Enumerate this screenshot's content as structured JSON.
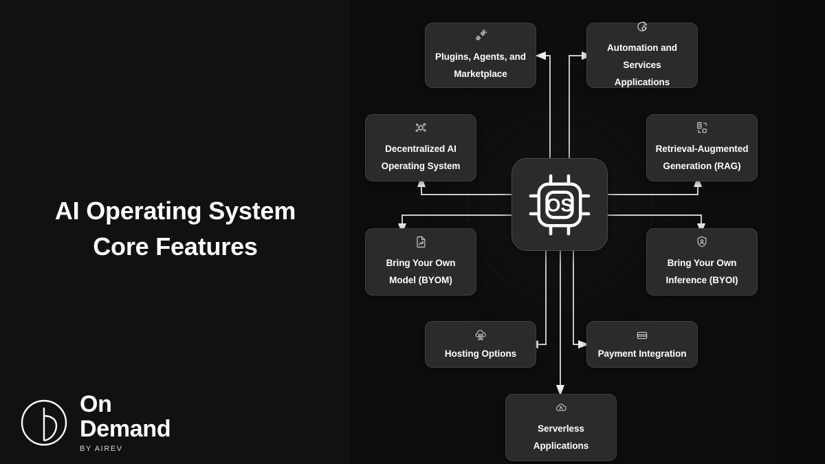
{
  "meta": {
    "title_line_1": "AI Operating System",
    "title_line_2": "Core Features",
    "background_left": "#111111",
    "background_right": "#0d0d0d",
    "card_background": "#2b2b2b",
    "card_border": "#3e3e3e",
    "text_color": "#ffffff",
    "connector_color": "#e8e8e8"
  },
  "logo": {
    "word_1": "On",
    "word_2": "Demand",
    "tagline": "BY AIREV",
    "mark_icon": "circle-d-logo-icon"
  },
  "hub": {
    "label": "OS",
    "icon": "cpu-chip-icon"
  },
  "cards": [
    {
      "id": "plugins-agents-marketplace",
      "icon": "plug-connect-icon",
      "line_1": "Plugins, Agents, and",
      "line_2": "Marketplace"
    },
    {
      "id": "automation-services-applications",
      "icon": "refresh-gear-icon",
      "line_1": "Automation and",
      "line_2": "Services Applications"
    },
    {
      "id": "decentralized-ai-operating-system",
      "icon": "network-nodes-icon",
      "line_1": "Decentralized AI",
      "line_2": "Operating System"
    },
    {
      "id": "retrieval-augmented-generation",
      "icon": "document-scan-icon",
      "line_1": "Retrieval-Augmented",
      "line_2": "Generation (RAG)"
    },
    {
      "id": "bring-your-own-model",
      "icon": "file-chart-icon",
      "line_1": "Bring Your Own",
      "line_2": "Model (BYOM)"
    },
    {
      "id": "bring-your-own-inference",
      "icon": "shield-user-icon",
      "line_1": "Bring Your Own",
      "line_2": "Inference (BYOI)"
    },
    {
      "id": "hosting-options",
      "icon": "cloud-server-icon",
      "line_1": "Hosting Options",
      "line_2": ""
    },
    {
      "id": "payment-integration",
      "icon": "credit-card-icon",
      "line_1": "Payment Integration",
      "line_2": ""
    },
    {
      "id": "serverless-applications",
      "icon": "cloud-lambda-icon",
      "line_1": "Serverless",
      "line_2": "Applications"
    }
  ]
}
